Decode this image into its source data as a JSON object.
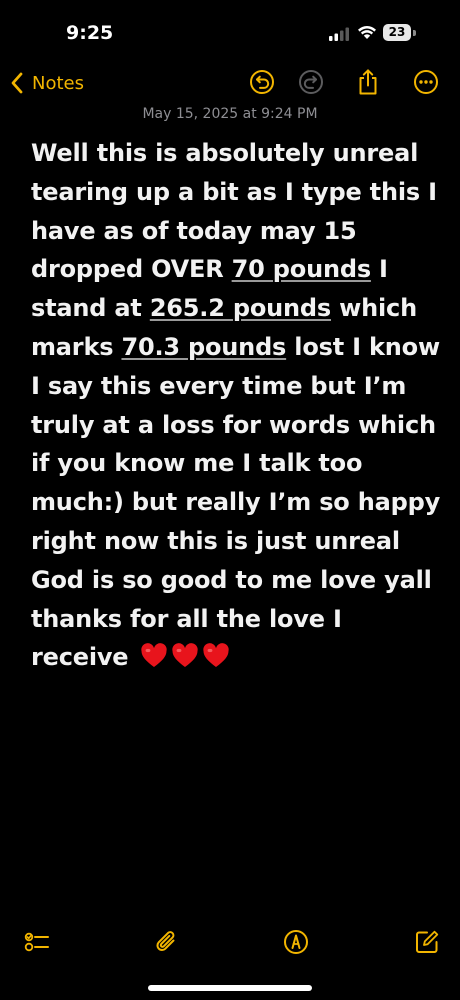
{
  "status_bar": {
    "time": "9:25",
    "battery_percent": "23",
    "signal_bars_active": 2,
    "icons": [
      "cellular-signal-icon",
      "wifi-icon",
      "battery-icon"
    ]
  },
  "nav": {
    "back_label": "Notes",
    "accent_color": "#f2b500",
    "icons": [
      "chevron-left-icon",
      "undo-icon",
      "redo-icon",
      "share-icon",
      "more-icon"
    ]
  },
  "note": {
    "date": "May 15, 2025 at 9:24 PM",
    "segments": [
      {
        "text": "Well this is absolutely unreal tearing up a bit as I type this I have as of today may 15 dropped OVER ",
        "link": false
      },
      {
        "text": "70 pounds",
        "link": true
      },
      {
        "text": " I stand at ",
        "link": false
      },
      {
        "text": "265.2 pounds",
        "link": true
      },
      {
        "text": " which marks ",
        "link": false
      },
      {
        "text": "70.3 pounds",
        "link": true
      },
      {
        "text": " lost I know I say this every time but I’m truly at a loss for words which if you know me I talk too much:) but really I’m so happy right now this is just unreal God is so good to me love yall thanks for all the love I receive",
        "link": false
      }
    ],
    "emoji": [
      "red-heart",
      "red-heart",
      "red-heart"
    ]
  },
  "toolbar": {
    "icons": [
      "checklist-icon",
      "attachment-icon",
      "markup-icon",
      "compose-icon"
    ]
  }
}
